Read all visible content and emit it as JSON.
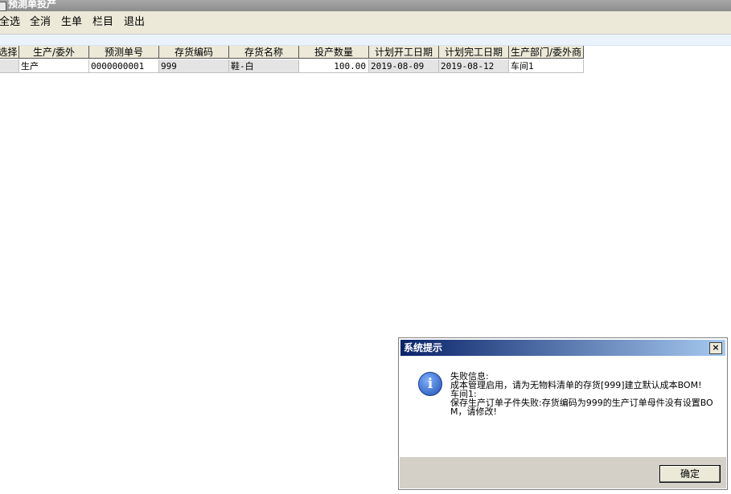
{
  "window": {
    "title": "预测单投产"
  },
  "toolbar": {
    "select_all": "全选",
    "deselect_all": "全消",
    "generate": "生单",
    "columns": "栏目",
    "exit": "退出"
  },
  "grid": {
    "headers": [
      "选择",
      "生产/委外",
      "预测单号",
      "存货编码",
      "存货名称",
      "投产数量",
      "计划开工日期",
      "计划完工日期",
      "生产部门/委外商"
    ],
    "rows": [
      {
        "select": "",
        "type": "生产",
        "forecast_no": "0000000001",
        "item_code": "999",
        "item_name": "鞋-白",
        "quantity": "100.00",
        "plan_start": "2019-08-09",
        "plan_end": "2019-08-12",
        "department": "车间1"
      }
    ]
  },
  "dialog": {
    "title": "系统提示",
    "close": "×",
    "icon": "info-icon",
    "message": "失败信息:\n成本管理启用，请为无物料清单的存货[999]建立默认成本BOM!\n车间1:\n保存生产订单子件失败:存货编码为999的生产订单母件没有设置BOM，请修改!",
    "ok": "确定"
  }
}
